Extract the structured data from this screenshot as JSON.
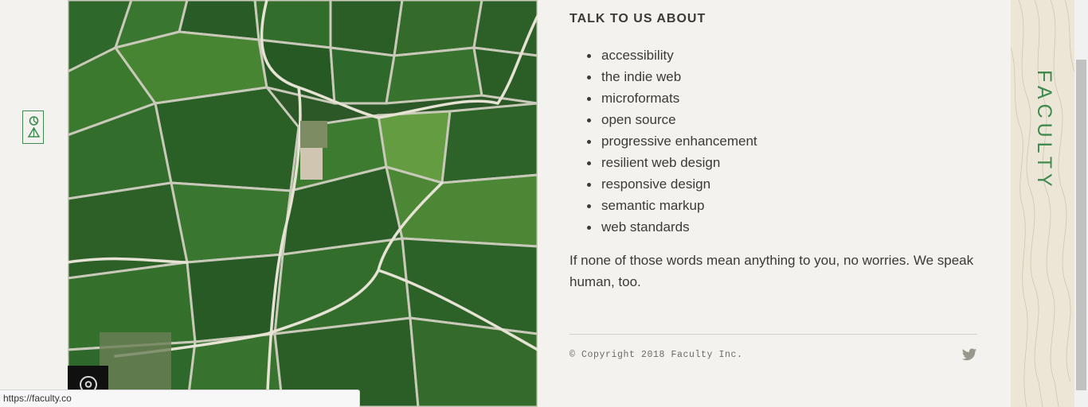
{
  "brand": {
    "name": "FACULTY"
  },
  "talk": {
    "heading": "TALK TO US ABOUT",
    "topics": [
      "accessibility",
      "the indie web",
      "microformats",
      "open source",
      "progressive enhancement",
      "resilient web design",
      "responsive design",
      "semantic markup",
      "web standards"
    ],
    "closing": "If none of those words mean anything to you, no worries. We speak human, too."
  },
  "footer": {
    "copyright": "© Copyright 2018 Faculty Inc."
  },
  "icons": {
    "logo": "faculty-logo-icon",
    "location": "map-pin-icon",
    "social": "twitter-icon"
  },
  "colors": {
    "accent": "#3f8a4f",
    "background": "#f4f2ee",
    "text": "#3b3a36"
  },
  "status_bar": {
    "url": "https://faculty.co"
  }
}
